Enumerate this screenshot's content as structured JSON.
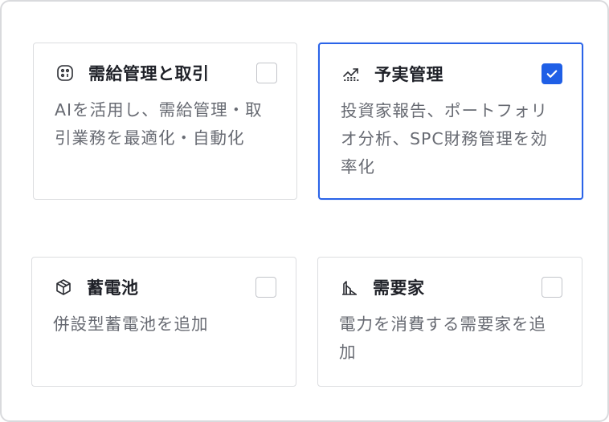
{
  "options": [
    {
      "title": "需給管理と取引",
      "description": "AIを活用し、需給管理・取引業務を最適化・自動化",
      "icon": "ai-chip-icon",
      "checked": false
    },
    {
      "title": "予実管理",
      "description": "投資家報告、ポートフォリオ分析、SPC財務管理を効率化",
      "icon": "growth-chart-icon",
      "checked": true
    },
    {
      "title": "蓄電池",
      "description": "併設型蓄電池を追加",
      "icon": "cube-icon",
      "checked": false
    },
    {
      "title": "需要家",
      "description": "電力を消費する需要家を追加",
      "icon": "factory-icon",
      "checked": false
    }
  ],
  "colors": {
    "accent": "#1f5fe6",
    "border": "#dcdde0",
    "title": "#1f2128",
    "description": "#676a72"
  }
}
